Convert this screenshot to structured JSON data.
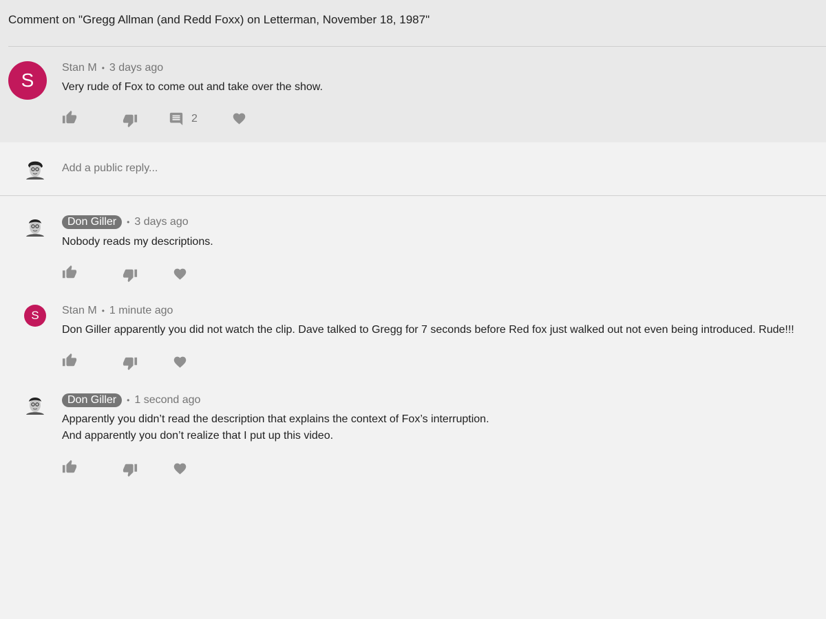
{
  "header": {
    "title": "Comment on \"Gregg Allman (and Redd Foxx) on Letterman, November 18, 1987\""
  },
  "colors": {
    "accent_avatar": "#c2185b",
    "chip": "#757575",
    "icon": "#909090"
  },
  "top_comment": {
    "avatar_letter": "S",
    "author": "Stan M",
    "time": "3 days ago",
    "text": "Very rude of Fox to come out and take over the show.",
    "reply_count": "2"
  },
  "reply_box": {
    "placeholder": "Add a public reply..."
  },
  "replies": [
    {
      "author": "Don Giller",
      "is_creator": true,
      "time": "3 days ago",
      "lines": [
        "Nobody reads my descriptions."
      ]
    },
    {
      "avatar_letter": "S",
      "author": "Stan M",
      "is_creator": false,
      "time": "1 minute ago",
      "lines": [
        "Don Giller apparently you did not watch the clip. Dave talked to Gregg for 7 seconds before Red fox just walked out not even being introduced. Rude!!!"
      ]
    },
    {
      "author": "Don Giller",
      "is_creator": true,
      "time": "1 second ago",
      "lines": [
        "Apparently you didn’t read the description that explains the context of Fox’s interruption.",
        "And apparently you don’t realize that I put up this video."
      ]
    }
  ],
  "icons": {
    "like": "thumb-up-icon",
    "dislike": "thumb-down-icon",
    "reply": "comment-icon",
    "heart": "heart-icon"
  }
}
